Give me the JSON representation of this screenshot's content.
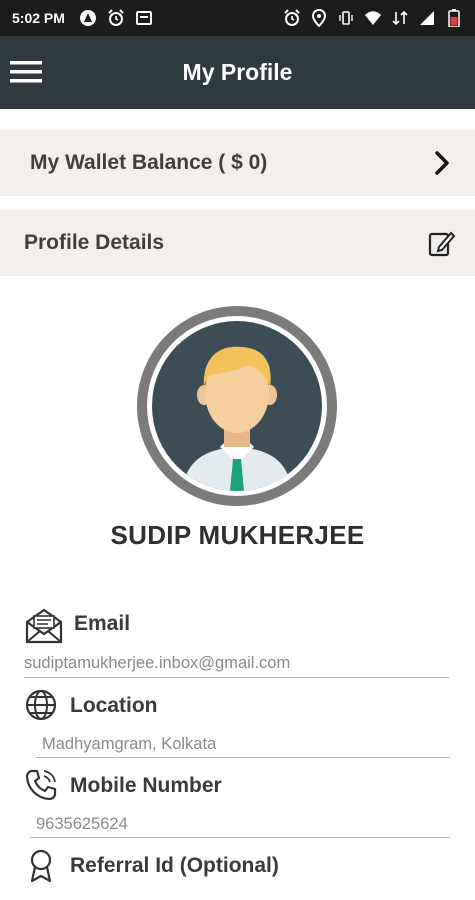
{
  "status_bar": {
    "time": "5:02 PM",
    "icons_left": [
      "notification-a-icon",
      "alarm-icon",
      "image-icon"
    ],
    "icons_right": [
      "alarm-icon",
      "location-icon",
      "vibrate-icon",
      "wifi-icon",
      "data-icon",
      "signal-icon",
      "battery-icon"
    ]
  },
  "app_bar": {
    "title": "My Profile",
    "background": "#2f3a3f"
  },
  "wallet": {
    "label": "My Wallet Balance ( $ 0)"
  },
  "profile_details": {
    "label": "Profile Details"
  },
  "user": {
    "name": "SUDIP MUKHERJEE"
  },
  "fields": {
    "email": {
      "label": "Email",
      "value": "sudiptamukherjee.inbox@gmail.com",
      "icon": "envelope-icon"
    },
    "location": {
      "label": "Location",
      "value": "Madhyamgram, Kolkata",
      "icon": "globe-icon"
    },
    "mobile": {
      "label": "Mobile Number",
      "value": "9635625624",
      "icon": "phone-icon"
    },
    "referral": {
      "label": "Referral Id (Optional)",
      "icon": "badge-icon"
    }
  }
}
